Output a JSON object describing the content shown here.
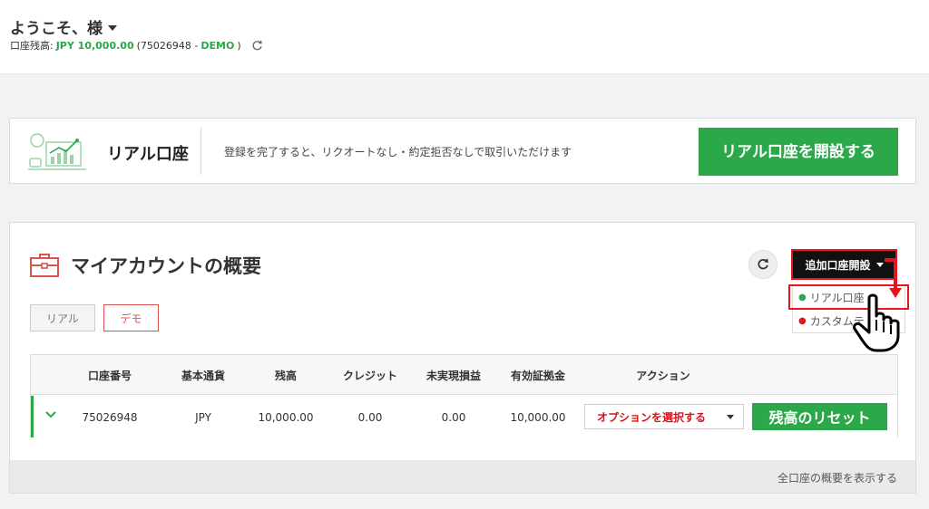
{
  "header": {
    "welcome": "ようこそ、様",
    "balance_label": "口座残高:",
    "balance_value": "JPY 10,000.00",
    "account_open": "(75026948 -",
    "account_type": "DEMO",
    "account_close": ")"
  },
  "banner": {
    "title": "リアル口座",
    "text": "登録を完了すると、リクオートなし・約定拒否なしで取引いただけます",
    "button": "リアル口座を開設する"
  },
  "panel": {
    "title": "マイアカウントの概要",
    "add_button": "追加口座開設",
    "tabs": {
      "real": "リアル",
      "demo": "デモ"
    },
    "dropdown": [
      {
        "label": "リアル口座",
        "dot_color": "#2aa84a"
      },
      {
        "label": "カスタムテ",
        "dot_color": "#e8141c"
      }
    ],
    "columns": [
      "口座番号",
      "基本通貨",
      "残高",
      "クレジット",
      "未実現損益",
      "有効証拠金",
      "アクション"
    ],
    "rows": [
      {
        "account": "75026948",
        "currency": "JPY",
        "balance": "10,000.00",
        "credit": "0.00",
        "unrealized": "0.00",
        "equity": "10,000.00",
        "select": "オプションを選択する",
        "reset": "残高のリセット"
      }
    ],
    "footer_link": "全口座の概要を表示する"
  },
  "colors": {
    "accent_green": "#2aa84a",
    "alert_red": "#e8141c"
  }
}
